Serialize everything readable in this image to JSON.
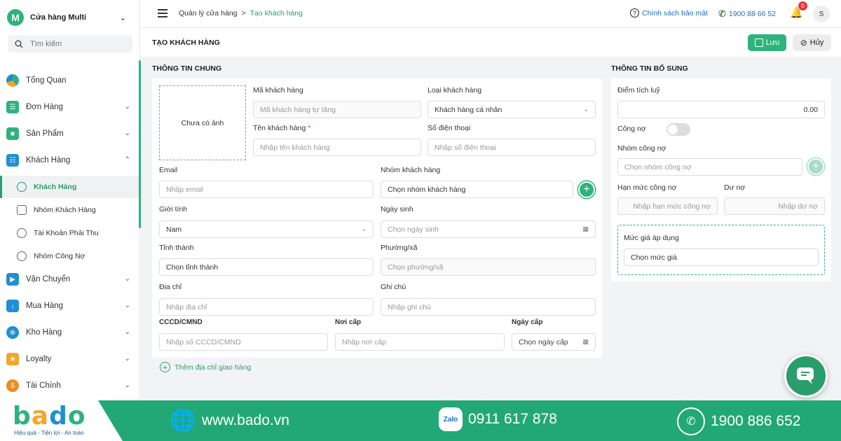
{
  "store": {
    "initial": "M",
    "name": "Cửa hàng Multi"
  },
  "search": {
    "placeholder": "Tìm kiếm"
  },
  "sidebar": {
    "items": [
      {
        "label": "Tổng Quan"
      },
      {
        "label": "Đơn Hàng"
      },
      {
        "label": "Sản Phẩm"
      },
      {
        "label": "Khách Hàng"
      },
      {
        "label": "Vận Chuyển"
      },
      {
        "label": "Mua Hàng"
      },
      {
        "label": "Kho Hàng"
      },
      {
        "label": "Loyalty"
      },
      {
        "label": "Tài Chính"
      }
    ],
    "sub_items": [
      {
        "label": "Khách Hàng"
      },
      {
        "label": "Nhóm Khách Hàng"
      },
      {
        "label": "Tài Khoản Phải Thu"
      },
      {
        "label": "Nhóm Công Nợ"
      }
    ]
  },
  "topbar": {
    "breadcrumb": [
      "Quản lý cửa hàng",
      ">",
      "Tạo khách hàng"
    ],
    "policy": "Chính sách bảo mật",
    "hotline": "1900 88 66 52",
    "notifications": "0",
    "user_initial": "S"
  },
  "page": {
    "title": "TẠO KHÁCH HÀNG",
    "save": "Lưu",
    "cancel": "Hủy"
  },
  "general": {
    "title": "THÔNG TIN CHUNG",
    "photo": "Chưa có ảnh",
    "code_label": "Mã khách hàng",
    "code_ph": "Mã khách hàng tự tăng",
    "type_label": "Loại khách hàng",
    "type_value": "Khách hàng cá nhân",
    "name_label": "Tên khách hàng",
    "name_req": "*",
    "name_ph": "Nhập tên khách hàng",
    "phone_label": "Số điện thoại",
    "phone_ph": "Nhập số điện thoại",
    "email_label": "Email",
    "email_ph": "Nhập email",
    "group_label": "Nhóm khách hàng",
    "group_value": "Chọn nhóm khách hàng",
    "gender_label": "Giới tính",
    "gender_value": "Nam",
    "dob_label": "Ngày sinh",
    "dob_ph": "Chọn ngày sinh",
    "province_label": "Tỉnh thành",
    "province_value": "Chọn tỉnh thành",
    "ward_label": "Phường/xã",
    "ward_ph": "Chọn phường/xã",
    "address_label": "Địa chỉ",
    "address_ph": "Nhập địa chỉ",
    "note_label": "Ghi chú",
    "note_ph": "Nhập ghi chú",
    "id_label": "CCCD/CMND",
    "id_ph": "Nhập số CCCD/CMND",
    "issue_place_label": "Nơi cấp",
    "issue_place_ph": "Nhập nơi cấp",
    "issue_date_label": "Ngày cấp",
    "issue_date_ph": "Chọn ngày cấp",
    "add_address": "Thêm địa chỉ giao hàng"
  },
  "extra": {
    "title": "THÔNG TIN BỔ SUNG",
    "points_label": "Điểm tích luỹ",
    "points_value": "0.00",
    "debt_label": "Công nợ",
    "debt_group_label": "Nhóm công nợ",
    "debt_group_ph": "Chọn nhóm công nợ",
    "limit_label": "Hạn mức công nợ",
    "limit_ph": "Nhập hạn mức công nợ",
    "balance_label": "Dư nợ",
    "balance_ph": "Nhập dư nợ",
    "price_label": "Mức giá áp dụng",
    "price_value": "Chọn mức giá"
  },
  "footer": {
    "logo": "bado",
    "tagline": "Hiệu quả - Tiện lợi - An toàn",
    "website": "www.bado.vn",
    "zalo_label": "Zalo",
    "zalo": "0911 617 878",
    "hotline": "1900 886 652"
  },
  "colors": {
    "accent": "#2db37e",
    "footer": "#22a877",
    "link": "#1f6fb2"
  }
}
